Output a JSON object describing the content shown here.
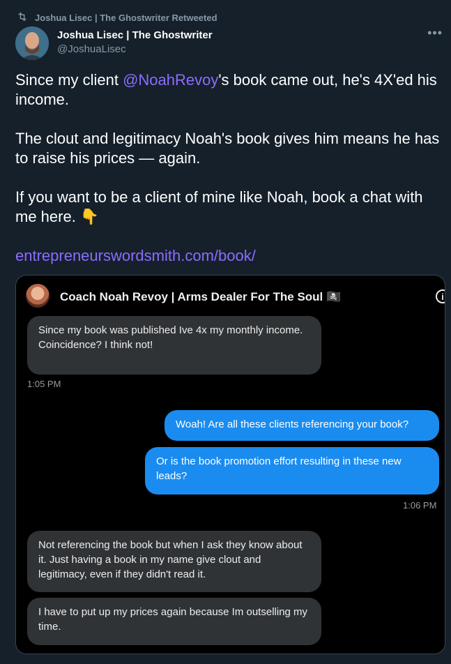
{
  "retweet": {
    "text": "Joshua Lisec | The Ghostwriter Retweeted"
  },
  "author": {
    "name": "Joshua Lisec | The Ghostwriter",
    "handle": "@JoshuaLisec"
  },
  "tweet": {
    "p1_pre": "Since my client ",
    "p1_mention": "@NoahRevoy",
    "p1_post": "'s book came out, he's 4X'ed his income.",
    "p2": "The clout and legitimacy Noah's book gives him means he has to raise his prices — again.",
    "p3": "If you want to be a client of mine like Noah, book a chat with me here. 👇",
    "link": "entrepreneurswordsmith.com/book/"
  },
  "chat": {
    "title": "Coach Noah Revoy | Arms Dealer For The Soul 🏴‍☠️",
    "messages": [
      {
        "text": "Since my book was published Ive 4x my monthly income.\nCoincidence? I think not!"
      },
      {
        "time": "1:05 PM"
      },
      {
        "text": "Woah! Are all these clients referencing your book?"
      },
      {
        "text": "Or is the book promotion effort resulting in these new leads?"
      },
      {
        "time": "1:06 PM"
      },
      {
        "text": "Not referencing the book but when I ask they know about it. Just having a book in my name give clout and legitimacy, even if they didn't read it."
      },
      {
        "text": "I have to put up my prices again because Im outselling my time."
      }
    ]
  },
  "icons": {
    "retweet": "retweet-icon",
    "more": "more-icon",
    "info": "info-icon"
  }
}
